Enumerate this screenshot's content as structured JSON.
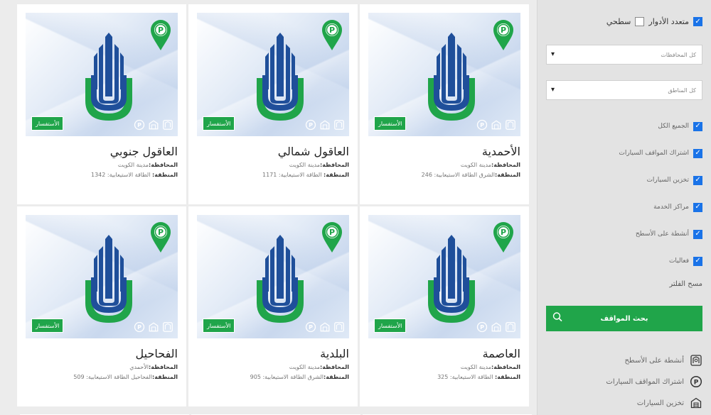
{
  "sidebar": {
    "types": [
      {
        "label": "متعدد الأدوار",
        "checked": true
      },
      {
        "label": "سطحي",
        "checked": false
      }
    ],
    "governorate_placeholder": "كل المحافظات",
    "area_placeholder": "كل المناطق",
    "filters": [
      {
        "label": "الجميع الكل",
        "checked": true
      },
      {
        "label": "اشتراك المواقف السيارات",
        "checked": true
      },
      {
        "label": "تخزين السيارات",
        "checked": true
      },
      {
        "label": "مراكز الخدمة",
        "checked": true
      },
      {
        "label": "أنشطة على الأسطح",
        "checked": true
      },
      {
        "label": "فعاليات",
        "checked": true
      }
    ],
    "clear_filter": "مسح الفلتر",
    "search_button": "بحث المواقف",
    "legend": [
      {
        "label": "أنشطة على الأسطح",
        "icon": "rooftop-icon"
      },
      {
        "label": "اشتراك المواقف السيارات",
        "icon": "parking-icon"
      },
      {
        "label": "تخزين السيارات",
        "icon": "storage-icon"
      }
    ]
  },
  "labels": {
    "governorate": "المحافظة:",
    "area": "المنطقة:",
    "inquiry": "الأستفسار"
  },
  "cards": [
    {
      "title": "الأحمدية",
      "governorate": "مدينة الكويت",
      "area": "الشرق",
      "capacity": "الطاقة الاستيعابية: 246"
    },
    {
      "title": "العاقول شمالي",
      "governorate": "مدينة الكويت",
      "area": "",
      "capacity": "الطاقة الاستيعابية: 1171"
    },
    {
      "title": "العاقول جنوبي",
      "governorate": "مدينة الكويت",
      "area": "",
      "capacity": "الطاقة الاستيعابية: 1342"
    },
    {
      "title": "العاصمة",
      "governorate": "مدينة الكويت",
      "area": "",
      "capacity": "الطاقة الاستيعابية: 325"
    },
    {
      "title": "البلدية",
      "governorate": "مدينة الكويت",
      "area": "الشرق",
      "capacity": "الطاقة الاستيعابية: 905"
    },
    {
      "title": "الفحاحيل",
      "governorate": "الأحمدي",
      "area": "الفحاحيل",
      "capacity": "الطاقة الاستيعابية: 509"
    }
  ],
  "colors": {
    "brand_green": "#20a54a",
    "logo_blue": "#1f4f9a",
    "checkbox_blue": "#1a73e8"
  }
}
